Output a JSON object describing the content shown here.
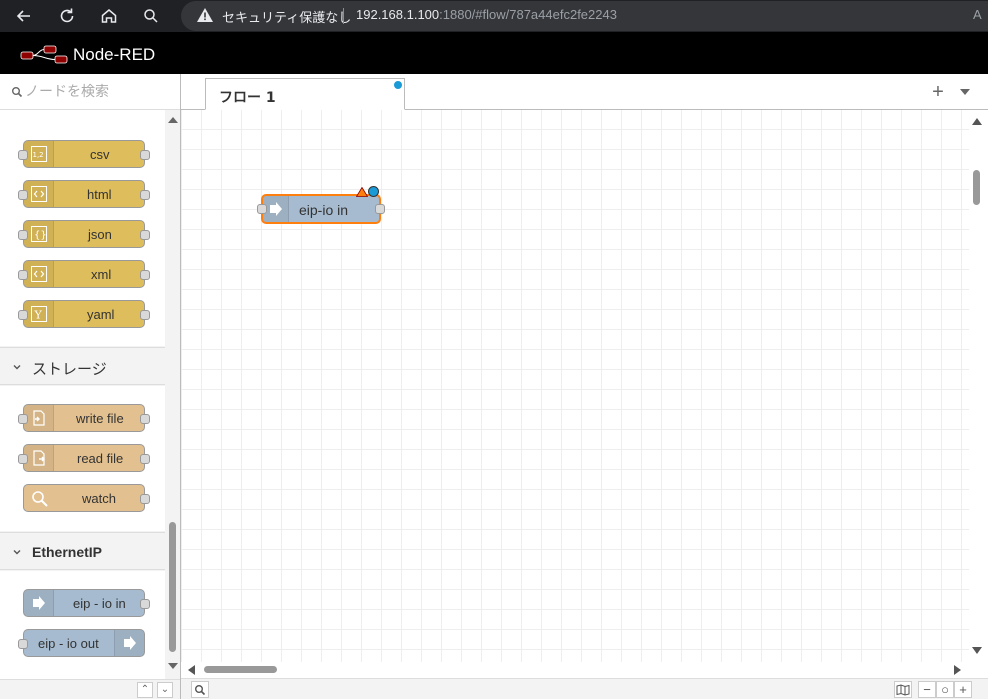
{
  "browser": {
    "security_label": "セキュリティ保護なし",
    "url_host": "192.168.1.100",
    "url_rest": ":1880/#flow/787a44efc2fe2243",
    "reader_label": "A",
    "nav": [
      {
        "name": "back-icon",
        "glyph": "←"
      },
      {
        "name": "reload-icon",
        "glyph": "↻"
      },
      {
        "name": "home-icon",
        "glyph": "⌂"
      },
      {
        "name": "search-icon",
        "glyph": "⚲"
      }
    ]
  },
  "header": {
    "title": "Node-RED"
  },
  "palette": {
    "search_placeholder": "ノードを検索",
    "parser_nodes": [
      {
        "label": "csv",
        "icon": "csv-icon",
        "glyph": "1,2"
      },
      {
        "label": "html",
        "icon": "html-icon",
        "glyph": "‹›"
      },
      {
        "label": "json",
        "icon": "json-icon",
        "glyph": "{}"
      },
      {
        "label": "xml",
        "icon": "xml-icon",
        "glyph": "‹›"
      },
      {
        "label": "yaml",
        "icon": "yaml-icon",
        "glyph": "Y"
      }
    ],
    "storage_category": "ストレージ",
    "storage_nodes": [
      {
        "label": "write file",
        "icon": "write-file-icon"
      },
      {
        "label": "read file",
        "icon": "read-file-icon"
      },
      {
        "label": "watch",
        "icon": "watch-icon"
      }
    ],
    "ethernetip_category": "EthernetIP",
    "ethernetip_nodes": [
      {
        "label": "eip - io in",
        "icon": "arrow-in-icon"
      },
      {
        "label": "eip - io out",
        "icon": "arrow-out-icon"
      }
    ]
  },
  "workspace": {
    "tab_label": "フロー 1",
    "add_tab": "+",
    "node": {
      "label": "eip-io in"
    }
  },
  "colors": {
    "parser": "#debd5c",
    "storage": "#e2c08f",
    "ethernetip": "#a6bbcf",
    "selected_border": "#ff7f0e",
    "changed_dot": "#1a9ad6"
  }
}
